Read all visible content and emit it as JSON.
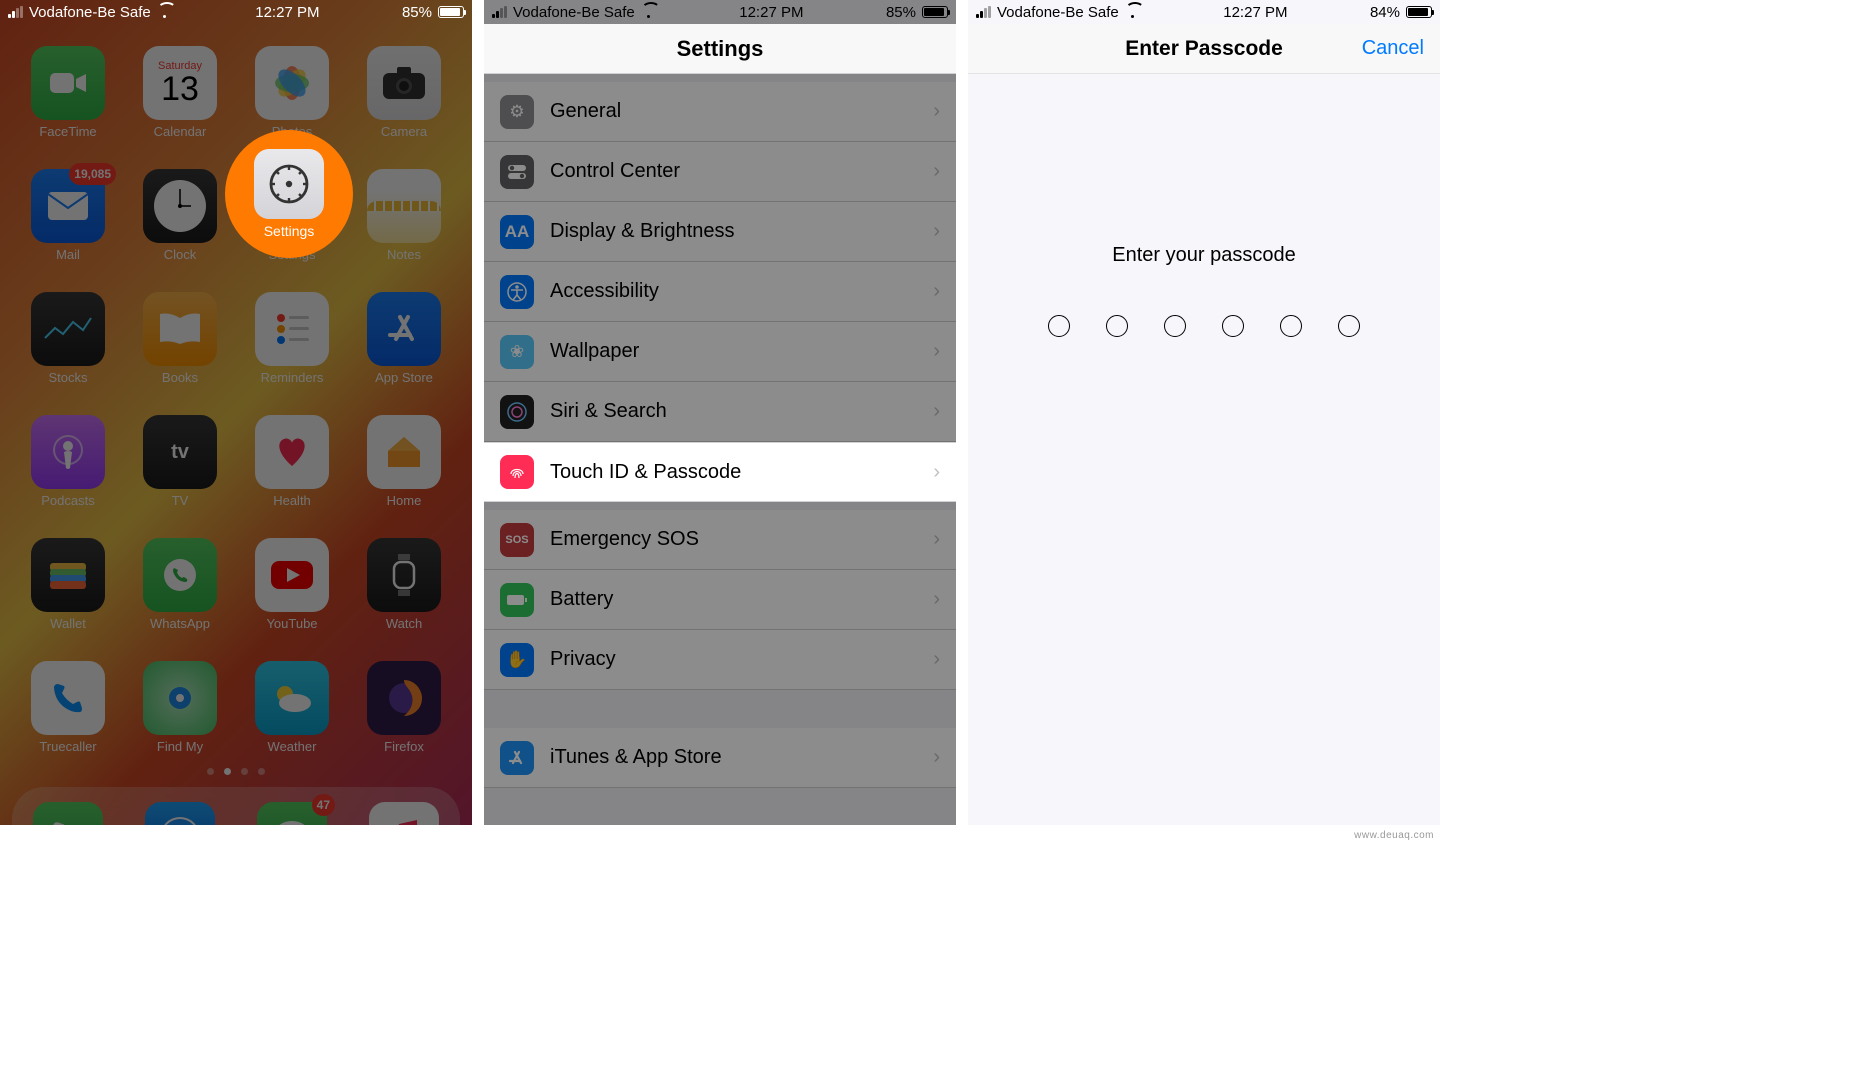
{
  "status": {
    "carrier": "Vodafone-Be Safe",
    "time": "12:27 PM",
    "battery_a": "85%",
    "battery_c": "84%"
  },
  "home": {
    "highlight": {
      "label": "Settings"
    },
    "apps": [
      {
        "label": "FaceTime"
      },
      {
        "label": "Calendar",
        "day": "Saturday",
        "date": "13"
      },
      {
        "label": "Photos"
      },
      {
        "label": "Camera"
      },
      {
        "label": "Mail",
        "badge": "19,085"
      },
      {
        "label": "Clock"
      },
      {
        "label": "Settings"
      },
      {
        "label": "Notes"
      },
      {
        "label": "Stocks"
      },
      {
        "label": "Books"
      },
      {
        "label": "Reminders"
      },
      {
        "label": "App Store"
      },
      {
        "label": "Podcasts"
      },
      {
        "label": "TV"
      },
      {
        "label": "Health"
      },
      {
        "label": "Home"
      },
      {
        "label": "Wallet"
      },
      {
        "label": "WhatsApp"
      },
      {
        "label": "YouTube"
      },
      {
        "label": "Watch"
      },
      {
        "label": "Truecaller"
      },
      {
        "label": "Find My"
      },
      {
        "label": "Weather"
      },
      {
        "label": "Firefox"
      }
    ],
    "dock_badge": "47"
  },
  "settings": {
    "title": "Settings",
    "rows": {
      "general": "General",
      "control_center": "Control Center",
      "display": "Display & Brightness",
      "accessibility": "Accessibility",
      "wallpaper": "Wallpaper",
      "siri": "Siri & Search",
      "touchid": "Touch ID & Passcode",
      "sos": "Emergency SOS",
      "battery": "Battery",
      "privacy": "Privacy",
      "itunes": "iTunes & App Store"
    }
  },
  "passcode": {
    "title": "Enter Passcode",
    "cancel": "Cancel",
    "prompt": "Enter your passcode"
  },
  "watermark": "www.deuaq.com"
}
